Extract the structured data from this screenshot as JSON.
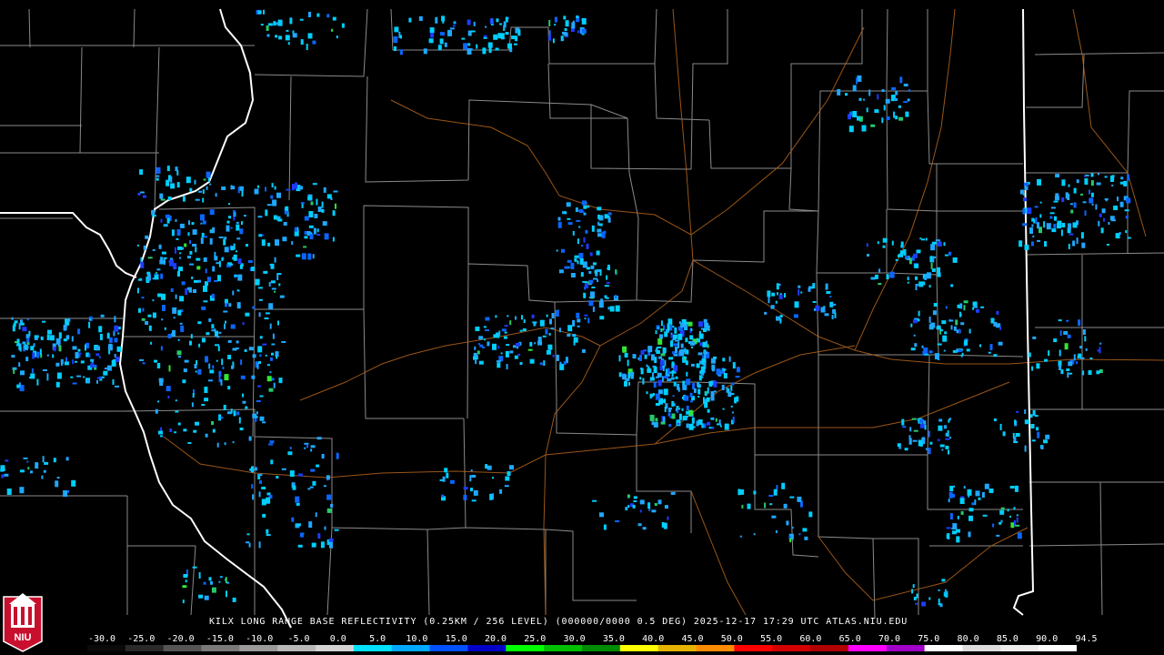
{
  "product": {
    "caption": "KILX LONG RANGE BASE REFLECTIVITY (0.25KM / 256 LEVEL) (000000/0000 0.5 DEG) 2025-12-17 17:29 UTC  ATLAS.NIU.EDU",
    "radar_site": "KILX",
    "elevation_angle": "0.5 DEG",
    "timestamp": "2025-12-17 17:29 UTC",
    "source": "ATLAS.NIU.EDU"
  },
  "logo": {
    "text": "NIU",
    "icon": "niu-seal-icon",
    "color": "#c8102e"
  },
  "legend": {
    "labels": [
      "-30.0",
      "-25.0",
      "-20.0",
      "-15.0",
      "-10.0",
      "-5.0",
      "0.0",
      "5.0",
      "10.0",
      "15.0",
      "20.0",
      "25.0",
      "30.0",
      "35.0",
      "40.0",
      "45.0",
      "50.0",
      "55.0",
      "60.0",
      "65.0",
      "70.0",
      "75.0",
      "80.0",
      "85.0",
      "90.0",
      "94.5"
    ],
    "colors": [
      "#0a0a0a",
      "#2a2a2a",
      "#555555",
      "#7a7a7a",
      "#9a9a9a",
      "#b8b8b8",
      "#d4d4d4",
      "#00e0ff",
      "#00a8ff",
      "#0050ff",
      "#0000c8",
      "#00ff00",
      "#00c000",
      "#008c00",
      "#ffff00",
      "#e6b400",
      "#ff8c00",
      "#ff0000",
      "#d40000",
      "#b00000",
      "#ff00ff",
      "#a000c8",
      "#ffffff",
      "#dddddd",
      "#eeeeee",
      "#ffffff"
    ]
  },
  "map": {
    "background": "#000000",
    "county_line_color": "#9a9a9a",
    "state_line_color": "#ffffff",
    "road_color": "#b5651d",
    "echo_colors": [
      "#00cfff",
      "#1fa8ff",
      "#0a66ff",
      "#1d3cff",
      "#27c96b",
      "#32e632"
    ]
  }
}
